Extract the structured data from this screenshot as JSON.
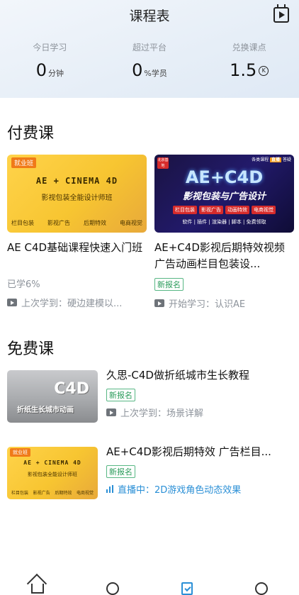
{
  "header": {
    "title": "课程表",
    "stats": [
      {
        "label": "今日学习",
        "value": "0",
        "unit": "分钟"
      },
      {
        "label": "超过平台",
        "value": "0",
        "unit": "%学员"
      },
      {
        "label": "兑换课点",
        "value": "1.5",
        "unit": "K"
      }
    ]
  },
  "paid": {
    "section_title": "付费课",
    "courses": [
      {
        "thumb": {
          "tag": "就业班",
          "main": "AE + CINEMA 4D",
          "sub": "影视包装全能设计师班",
          "foot": [
            "栏目包装",
            "影视广告",
            "后期特效",
            "电商视觉"
          ]
        },
        "title": "AE C4D基础课程快速入门班",
        "progress": "已学6%",
        "last": "上次学到：硬边建模以..."
      },
      {
        "thumb": {
          "badge_left": "北京基地",
          "badge_right_pre": "各类课程",
          "badge_right_hl": "直播",
          "badge_right_post": "答疑",
          "main": "AE+C4D",
          "sub": "影视包装与广告设计",
          "chips": [
            "栏目包装",
            "影视广告",
            "动画特效",
            "电商视觉"
          ],
          "foot": "软件 | 插件 | 渲染器 | 脚本 | 免费领取"
        },
        "title": "AE+C4D影视后期特效视频 广告动画栏目包装设...",
        "status": "新报名",
        "last": "开始学习：认识AE"
      }
    ]
  },
  "free": {
    "section_title": "免费课",
    "courses": [
      {
        "thumb": {
          "big": "C4D",
          "caption": "折纸生长城市动画"
        },
        "title": "久思-C4D做折纸城市生长教程",
        "status": "新报名",
        "last": "上次学到：场景详解"
      },
      {
        "thumb": {
          "tag": "就业班",
          "main": "AE + CINEMA 4D",
          "sub": "影视包装全能设计师班",
          "foot": [
            "栏目包装",
            "影视广告",
            "后期特效",
            "电商视觉"
          ]
        },
        "title": "AE+C4D影视后期特效 广告栏目...",
        "status": "新报名",
        "live": "直播中：2D游戏角色动态效果"
      }
    ]
  },
  "nav": [
    {
      "icon": "home-icon"
    },
    {
      "icon": "search-icon"
    },
    {
      "icon": "schedule-icon",
      "active": true
    },
    {
      "icon": "profile-icon"
    }
  ],
  "colors": {
    "accent": "#2a8fd6",
    "new_badge": "#2a9b5a",
    "thumb_yellow": "#f7c531",
    "tag_orange": "#f07a18"
  }
}
